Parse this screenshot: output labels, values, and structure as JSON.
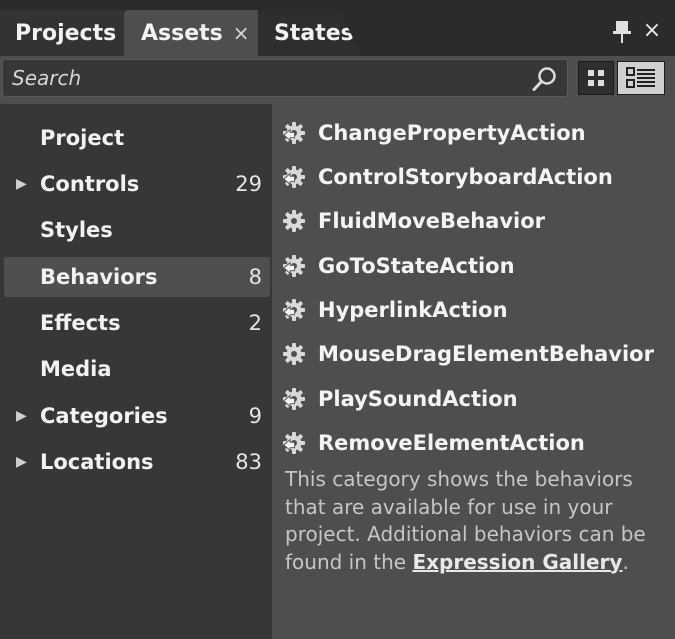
{
  "tabs": [
    {
      "label": "Projects"
    },
    {
      "label": "Assets",
      "close_icon": "×"
    },
    {
      "label": "States"
    }
  ],
  "window_controls": {
    "pin_icon": "pin-icon",
    "close_icon": "×"
  },
  "search": {
    "placeholder": "Search",
    "icon": "search-icon"
  },
  "view_toggle": {
    "grid_icon": "grid-view-icon",
    "list_icon": "list-view-icon",
    "selected": "list"
  },
  "categories": [
    {
      "label": "Project",
      "count": "",
      "expandable": false
    },
    {
      "label": "Controls",
      "count": "29",
      "expandable": true
    },
    {
      "label": "Styles",
      "count": "",
      "expandable": false
    },
    {
      "label": "Behaviors",
      "count": "8",
      "expandable": false,
      "selected": true
    },
    {
      "label": "Effects",
      "count": "2",
      "expandable": false
    },
    {
      "label": "Media",
      "count": "",
      "expandable": false
    },
    {
      "label": "Categories",
      "count": "9",
      "expandable": true
    },
    {
      "label": "Locations",
      "count": "83",
      "expandable": true
    }
  ],
  "assets": [
    {
      "label": "ChangePropertyAction",
      "icon": "action-gear-icon"
    },
    {
      "label": "ControlStoryboardAction",
      "icon": "action-gear-icon"
    },
    {
      "label": "FluidMoveBehavior",
      "icon": "behavior-gear-icon"
    },
    {
      "label": "GoToStateAction",
      "icon": "action-gear-icon"
    },
    {
      "label": "HyperlinkAction",
      "icon": "action-gear-icon"
    },
    {
      "label": "MouseDragElementBehavior",
      "icon": "behavior-gear-icon"
    },
    {
      "label": "PlaySoundAction",
      "icon": "action-gear-icon"
    },
    {
      "label": "RemoveElementAction",
      "icon": "action-gear-icon"
    }
  ],
  "description": {
    "text": "This category shows the behaviors that are available for use in your project. Additional behaviors can be found in the ",
    "link": "Expression Gallery",
    "end": "."
  },
  "colors": {
    "tab_strip_bg": "#2b2b2b",
    "active_tab_bg": "#4e4e4e",
    "category_bg": "#373737",
    "asset_bg": "#4e4e4e",
    "text": "#f2f2f2",
    "muted_text": "#c6c6c6"
  }
}
